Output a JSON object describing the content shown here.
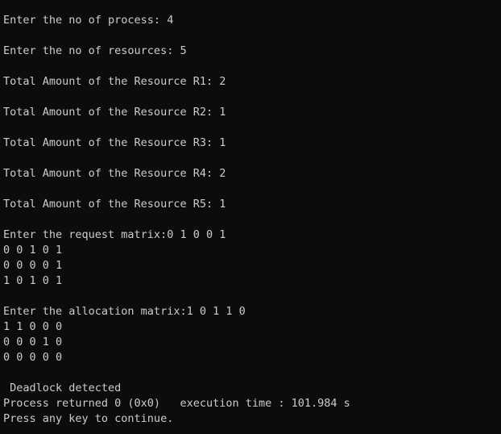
{
  "console": {
    "lines": [
      "Enter the no of process: 4",
      "",
      "Enter the no of resources: 5",
      "",
      "Total Amount of the Resource R1: 2",
      "",
      "Total Amount of the Resource R2: 1",
      "",
      "Total Amount of the Resource R3: 1",
      "",
      "Total Amount of the Resource R4: 2",
      "",
      "Total Amount of the Resource R5: 1",
      "",
      "Enter the request matrix:0 1 0 0 1",
      "0 0 1 0 1",
      "0 0 0 0 1",
      "1 0 1 0 1",
      "",
      "Enter the allocation matrix:1 0 1 1 0",
      "1 1 0 0 0",
      "0 0 0 1 0",
      "0 0 0 0 0",
      "",
      " Deadlock detected",
      "Process returned 0 (0x0)   execution time : 101.984 s",
      "Press any key to continue."
    ]
  }
}
